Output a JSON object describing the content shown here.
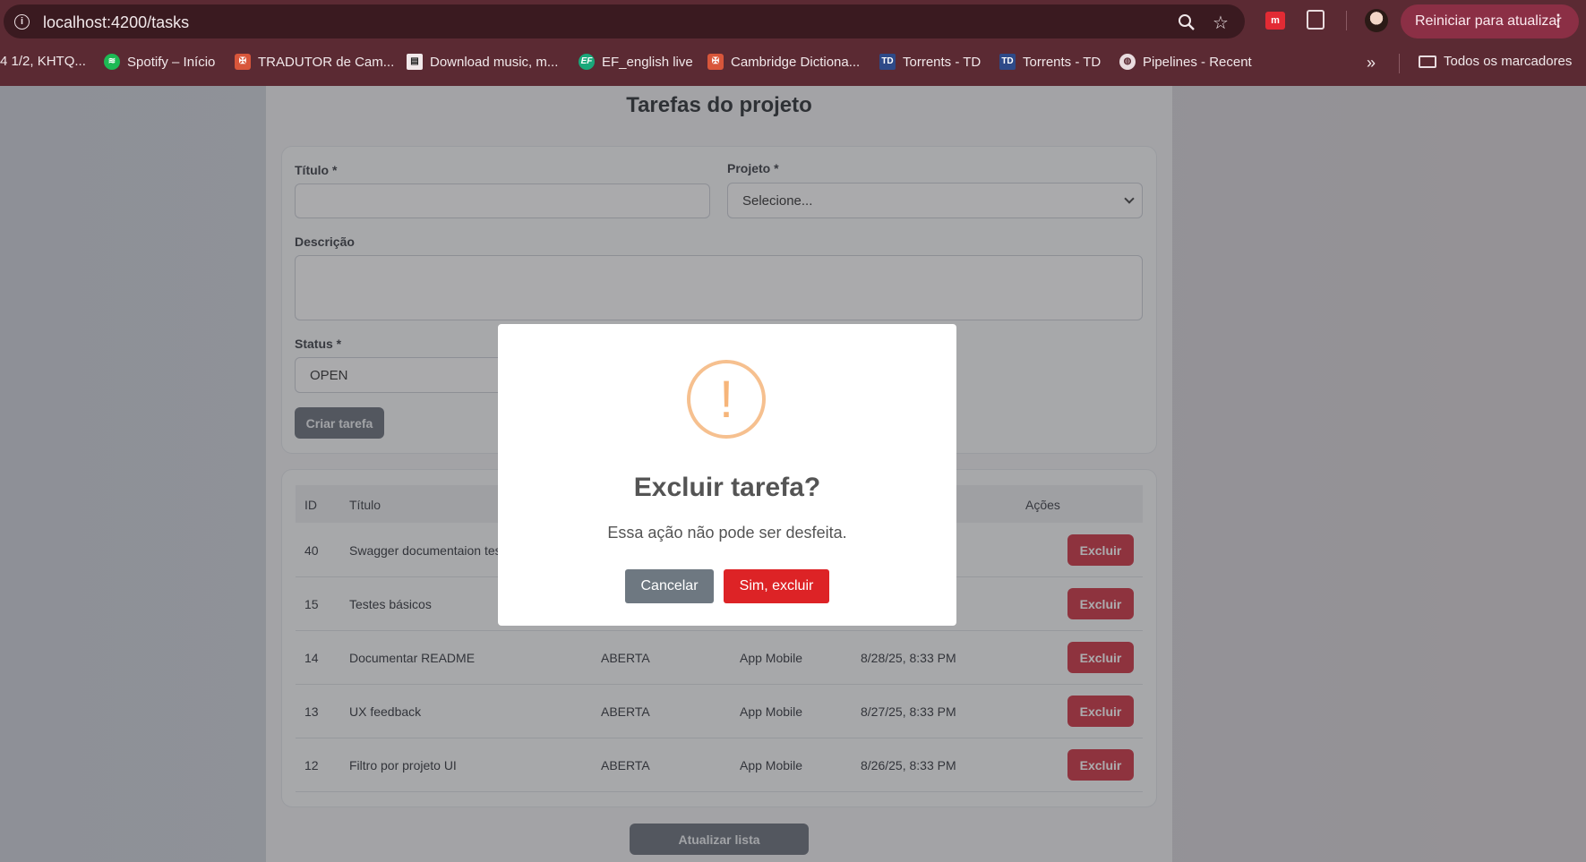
{
  "browser": {
    "url": "localhost:4200/tasks",
    "restart_label": "Reiniciar para atualizar",
    "ext_badge": "m",
    "bookmarks": [
      {
        "label": "4 1/2, KHTQ...",
        "icon": "page-icon"
      },
      {
        "label": "Spotify – Início",
        "icon": "spotify-icon"
      },
      {
        "label": "TRADUTOR de Cam...",
        "icon": "cambridge-icon"
      },
      {
        "label": "Download music, m...",
        "icon": "music-download-icon"
      },
      {
        "label": "EF_english live",
        "icon": "ef-icon"
      },
      {
        "label": "Cambridge Dictiona...",
        "icon": "cambridge-icon"
      },
      {
        "label": "Torrents - TD",
        "icon": "torrent-icon"
      },
      {
        "label": "Torrents - TD",
        "icon": "torrent-icon"
      },
      {
        "label": "Pipelines - Recent",
        "icon": "globe-icon"
      }
    ],
    "more_label": "»",
    "all_bookmarks": "Todos os marcadores"
  },
  "page": {
    "title": "Tarefas do projeto",
    "form": {
      "title_label": "Título *",
      "title_value": "",
      "project_label": "Projeto *",
      "project_selected": "Selecione...",
      "description_label": "Descrição",
      "description_value": "",
      "status_label": "Status *",
      "status_selected": "OPEN",
      "submit_label": "Criar tarefa"
    },
    "table": {
      "headers": [
        "ID",
        "Título",
        "Ações"
      ],
      "rows": [
        {
          "id": "40",
          "title": "Swagger documentaion tes",
          "status": "",
          "project": "",
          "date": "",
          "action": "Excluir"
        },
        {
          "id": "15",
          "title": "Testes básicos",
          "status": "",
          "project": "",
          "date": "",
          "action": "Excluir"
        },
        {
          "id": "14",
          "title": "Documentar README",
          "status": "ABERTA",
          "project": "App Mobile",
          "date": "8/28/25, 8:33 PM",
          "action": "Excluir"
        },
        {
          "id": "13",
          "title": "UX feedback",
          "status": "ABERTA",
          "project": "App Mobile",
          "date": "8/27/25, 8:33 PM",
          "action": "Excluir"
        },
        {
          "id": "12",
          "title": "Filtro por projeto UI",
          "status": "ABERTA",
          "project": "App Mobile",
          "date": "8/26/25, 8:33 PM",
          "action": "Excluir"
        }
      ]
    },
    "refresh_label": "Atualizar lista"
  },
  "modal": {
    "icon": "!",
    "title": "Excluir tarefa?",
    "text": "Essa ação não pode ser desfeita.",
    "cancel_label": "Cancelar",
    "confirm_label": "Sim, excluir"
  },
  "colors": {
    "chrome": "#5b2a33",
    "danger": "#c82333",
    "confirm": "#dd2326",
    "warning": "#f6c08f"
  }
}
